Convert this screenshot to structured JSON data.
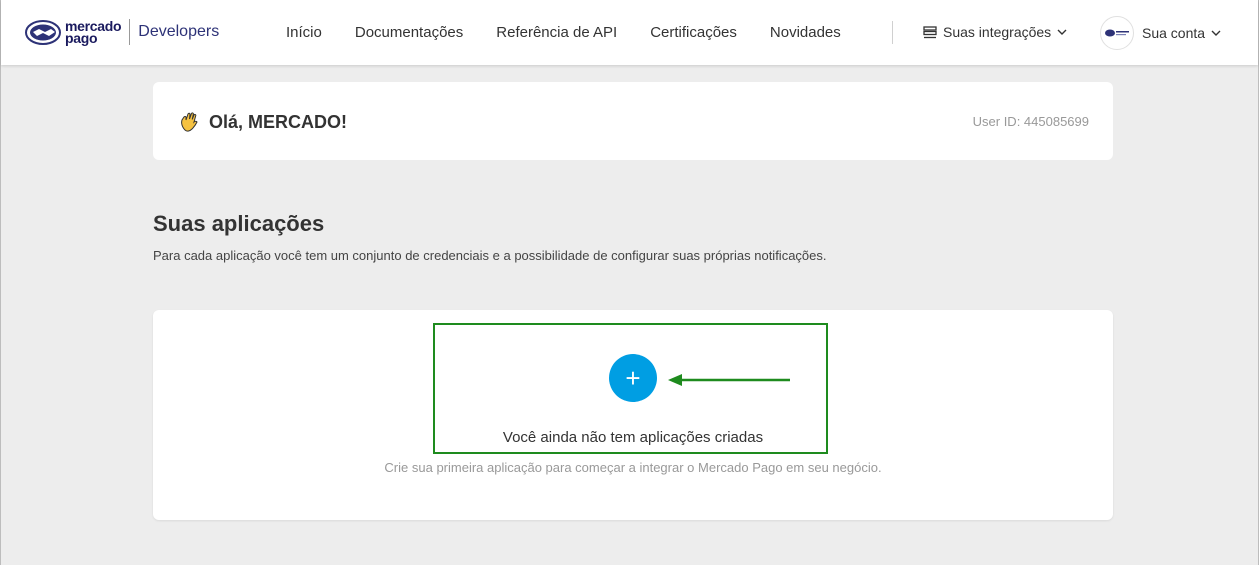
{
  "header": {
    "logo_line1": "mercado",
    "logo_line2": "pago",
    "logo_suffix": "Developers",
    "nav": [
      "Início",
      "Documentações",
      "Referência de API",
      "Certificações",
      "Novidades"
    ],
    "integrations_label": "Suas integrações",
    "account_label": "Sua conta"
  },
  "greeting": {
    "text": "Olá, MERCADO!",
    "user_id": "User ID: 445085699"
  },
  "applications": {
    "title": "Suas aplicações",
    "description": "Para cada aplicação você tem um conjunto de credenciais e a possibilidade de configurar suas próprias notificações.",
    "add_label": "+",
    "empty_title": "Você ainda não tem aplicações criadas",
    "empty_subtitle": "Crie sua primeira aplicação para começar a integrar o Mercado Pago em seu negócio."
  },
  "colors": {
    "accent": "#009ee3",
    "highlight": "#1e8b1e",
    "brand": "#2d3277"
  },
  "icons": [
    "handshake-logo-icon",
    "integrations-icon",
    "chevron-down-icon",
    "avatar-icon",
    "waving-hand-icon",
    "plus-icon",
    "arrow-left-icon"
  ]
}
